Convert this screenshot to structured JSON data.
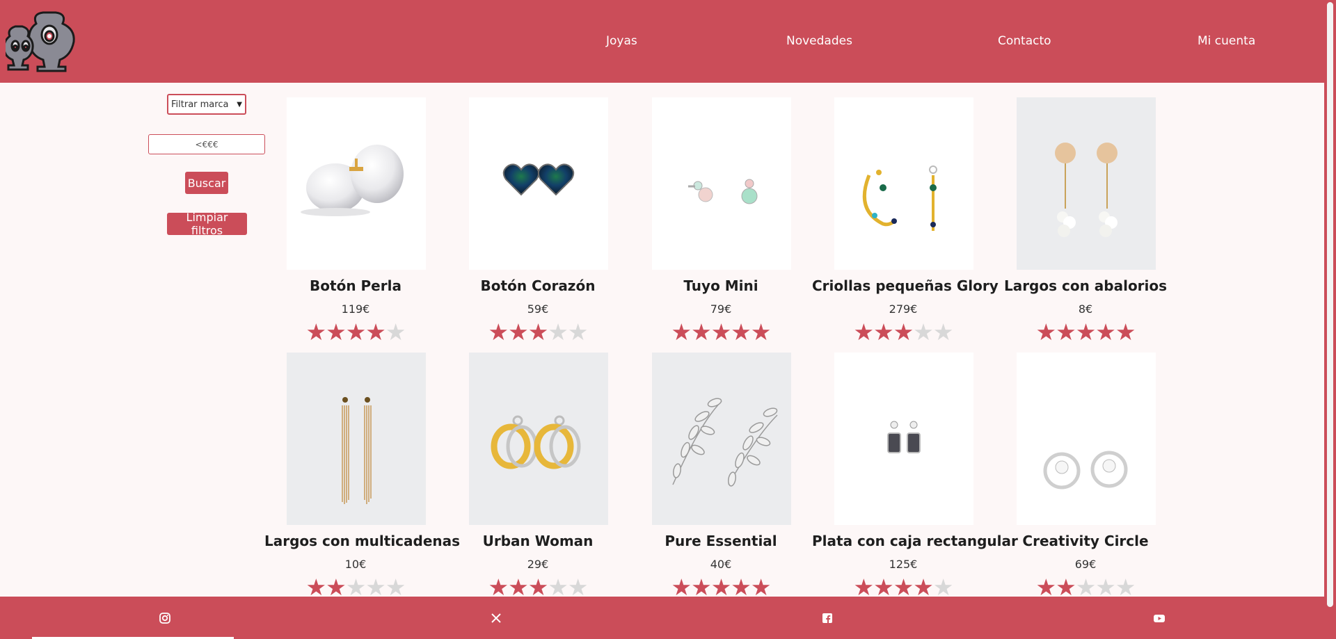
{
  "header": {
    "logo": "jewelry-logo",
    "nav": [
      {
        "label": "Joyas"
      },
      {
        "label": "Novedades"
      },
      {
        "label": "Contacto"
      },
      {
        "label": "Mi cuenta"
      }
    ]
  },
  "filters": {
    "brand_select": "Filtrar marca",
    "price_placeholder": "<€€€",
    "search_label": "Buscar",
    "clear_label": "Limpiar filtros"
  },
  "products": [
    {
      "name": "Botón Perla",
      "price": "119€",
      "rating": 4,
      "max": 5,
      "icon": "pearl-earrings"
    },
    {
      "name": "Botón Corazón",
      "price": "59€",
      "rating": 3,
      "max": 5,
      "icon": "heart-earrings"
    },
    {
      "name": "Tuyo Mini",
      "price": "79€",
      "rating": 5,
      "max": 5,
      "icon": "gem-stud-earrings"
    },
    {
      "name": "Criollas pequeñas Glory",
      "price": "279€",
      "rating": 3,
      "max": 5,
      "icon": "hoop-earrings"
    },
    {
      "name": "Largos con abalorios",
      "price": "8€",
      "rating": 5,
      "max": 5,
      "icon": "bead-drop-earrings"
    },
    {
      "name": "Largos con multicadenas",
      "price": "10€",
      "rating": 2,
      "max": 5,
      "icon": "chain-earrings"
    },
    {
      "name": "Urban Woman",
      "price": "29€",
      "rating": 3,
      "max": 5,
      "icon": "double-ring-earrings"
    },
    {
      "name": "Pure Essential",
      "price": "40€",
      "rating": 5,
      "max": 5,
      "icon": "leaf-climber-earrings"
    },
    {
      "name": "Plata con caja rectangular",
      "price": "125€",
      "rating": 4,
      "max": 5,
      "icon": "rectangular-drop-earrings"
    },
    {
      "name": "Creativity Circle",
      "price": "69€",
      "rating": 2,
      "max": 5,
      "icon": "circle-stud-earrings"
    }
  ],
  "footer": {
    "icons": [
      "instagram-icon",
      "x-icon",
      "facebook-icon",
      "youtube-icon"
    ]
  },
  "colors": {
    "brand": "#cb4d59",
    "background": "#fdf7f7"
  }
}
